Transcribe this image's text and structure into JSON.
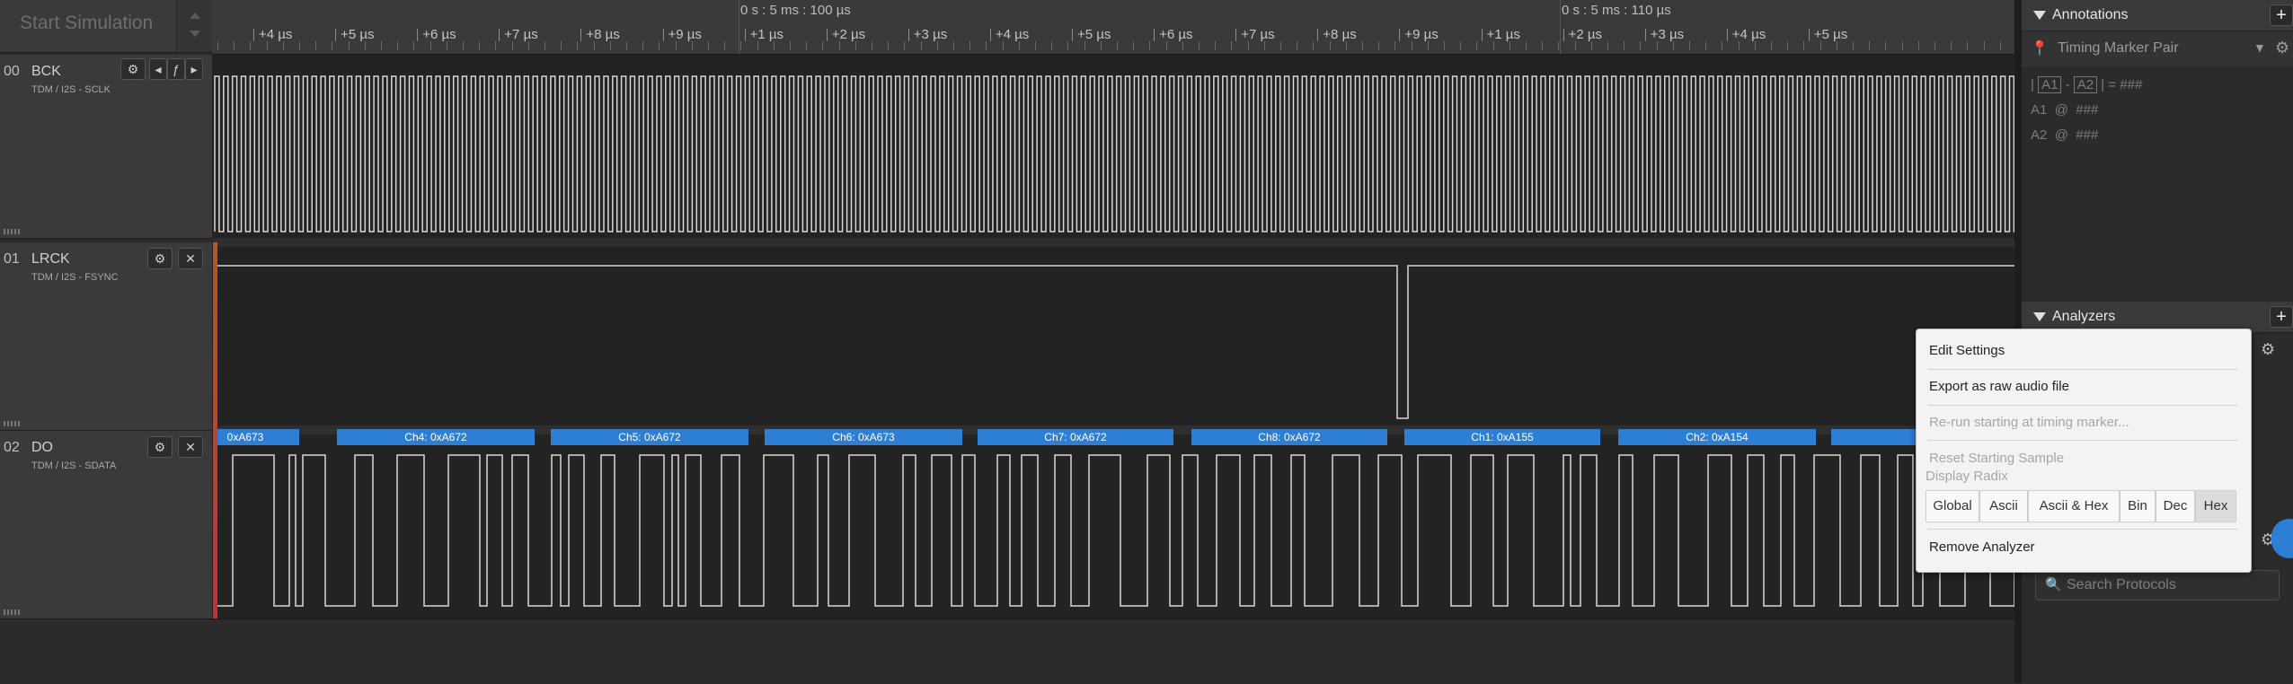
{
  "start_simulation": {
    "label": "Start Simulation"
  },
  "ruler": {
    "top_labels": [
      "0 s : 5 ms : 100 µs",
      "0 s : 5 ms : 110 µs"
    ],
    "ticks": [
      "+4 µs",
      "+5 µs",
      "+6 µs",
      "+7 µs",
      "+8 µs",
      "+9 µs",
      "+1 µs",
      "+2 µs",
      "+3 µs",
      "+4 µs",
      "+5 µs",
      "+6 µs",
      "+7 µs",
      "+8 µs",
      "+9 µs",
      "+1 µs",
      "+2 µs",
      "+3 µs",
      "+4 µs",
      "+5 µs"
    ]
  },
  "channels": [
    {
      "num": "00",
      "name": "BCK",
      "sub": "TDM / I2S - SCLK"
    },
    {
      "num": "01",
      "name": "LRCK",
      "sub": "TDM / I2S - FSYNC"
    },
    {
      "num": "02",
      "name": "DO",
      "sub": "TDM / I2S - SDATA"
    }
  ],
  "frames": [
    "0xA673",
    "Ch4: 0xA672",
    "Ch5: 0xA672",
    "Ch6: 0xA673",
    "Ch7: 0xA672",
    "Ch8: 0xA672",
    "Ch1: 0xA155",
    "Ch2: 0xA154",
    "Ch"
  ],
  "annotations": {
    "title": "Annotations",
    "marker_label": "Timing Marker Pair",
    "formula": {
      "a1": "A1",
      "a2": "A2",
      "sep": "-",
      "eq": "= ###"
    },
    "a1_row": {
      "name": "A1",
      "at": "@",
      "val": "###"
    },
    "a2_row": {
      "name": "A2",
      "at": "@",
      "val": "###"
    }
  },
  "analyzers": {
    "title": "Analyzers"
  },
  "search": {
    "placeholder": "Search Protocols"
  },
  "menu": {
    "edit_settings": "Edit Settings",
    "export_raw": "Export as raw audio file",
    "rerun": "Re-run starting at timing marker...",
    "reset_sample": "Reset Starting Sample",
    "display_radix": "Display Radix",
    "radix_options": [
      "Global",
      "Ascii",
      "Ascii & Hex",
      "Bin",
      "Dec",
      "Hex"
    ],
    "radix_selected": "Hex",
    "remove": "Remove Analyzer"
  },
  "colors": {
    "frame": "#2d7fd6",
    "marker_cursor": "#c63030",
    "accent_button": "#2d7fd6"
  }
}
